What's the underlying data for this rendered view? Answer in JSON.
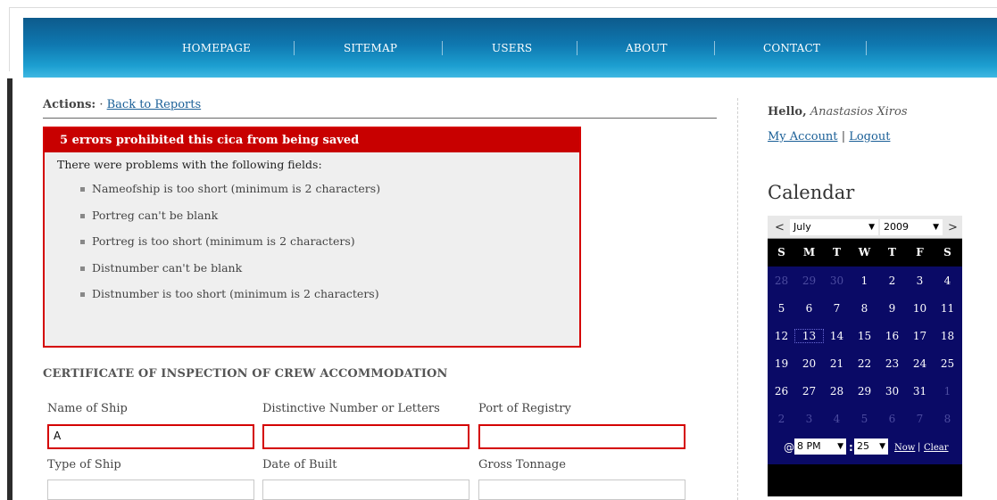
{
  "nav": {
    "items": [
      "HOMEPAGE",
      "SITEMAP",
      "USERS",
      "ABOUT",
      "CONTACT"
    ],
    "color_start": "#0d5a8c",
    "color_end": "#3fb8e2"
  },
  "actions": {
    "label": "Actions:",
    "bullet": "·",
    "back_link": "Back to Reports"
  },
  "errors": {
    "title": "5 errors prohibited this cica from being saved",
    "intro": "There were problems with the following fields:",
    "items": [
      "Nameofship is too short (minimum is 2 characters)",
      "Portreg can't be blank",
      "Portreg is too short (minimum is 2 characters)",
      "Distnumber can't be blank",
      "Distnumber is too short (minimum is 2 characters)"
    ],
    "color": "#c80000"
  },
  "form": {
    "section_title": "CERTIFICATE OF INSPECTION OF CREW ACCOMMODATION",
    "name_of_ship_label": "Name of Ship",
    "name_of_ship_value": "A",
    "distinctive_number_label": "Distinctive Number or Letters",
    "distinctive_number_value": "",
    "port_of_registry_label": "Port of Registry",
    "port_of_registry_value": "",
    "type_of_ship_label": "Type of Ship",
    "type_of_ship_value": "",
    "date_of_built_label": "Date of Built",
    "date_of_built_value": "",
    "gross_tonnage_label": "Gross Tonnage",
    "gross_tonnage_value": ""
  },
  "sidebar": {
    "hello_label": "Hello,",
    "user_name": "Anastasios Xiros",
    "my_account": "My Account",
    "separator": "|",
    "logout": "Logout",
    "calendar_title": "Calendar"
  },
  "calendar": {
    "prev": "<",
    "next": ">",
    "month": "July",
    "year": "2009",
    "weekdays": [
      "S",
      "M",
      "T",
      "W",
      "T",
      "F",
      "S"
    ],
    "weeks": [
      [
        "28",
        "29",
        "30",
        "1",
        "2",
        "3",
        "4"
      ],
      [
        "5",
        "6",
        "7",
        "8",
        "9",
        "10",
        "11"
      ],
      [
        "12",
        "13",
        "14",
        "15",
        "16",
        "17",
        "18"
      ],
      [
        "19",
        "20",
        "21",
        "22",
        "23",
        "24",
        "25"
      ],
      [
        "26",
        "27",
        "28",
        "29",
        "30",
        "31",
        "1"
      ],
      [
        "2",
        "3",
        "4",
        "5",
        "6",
        "7",
        "8"
      ]
    ],
    "selected_day": "13",
    "at": "@",
    "hour": "8 PM",
    "minute": "25",
    "time_colon": ":",
    "now": "Now",
    "pipe": "|",
    "clear": "Clear",
    "bg_color": "#0a0a66"
  }
}
